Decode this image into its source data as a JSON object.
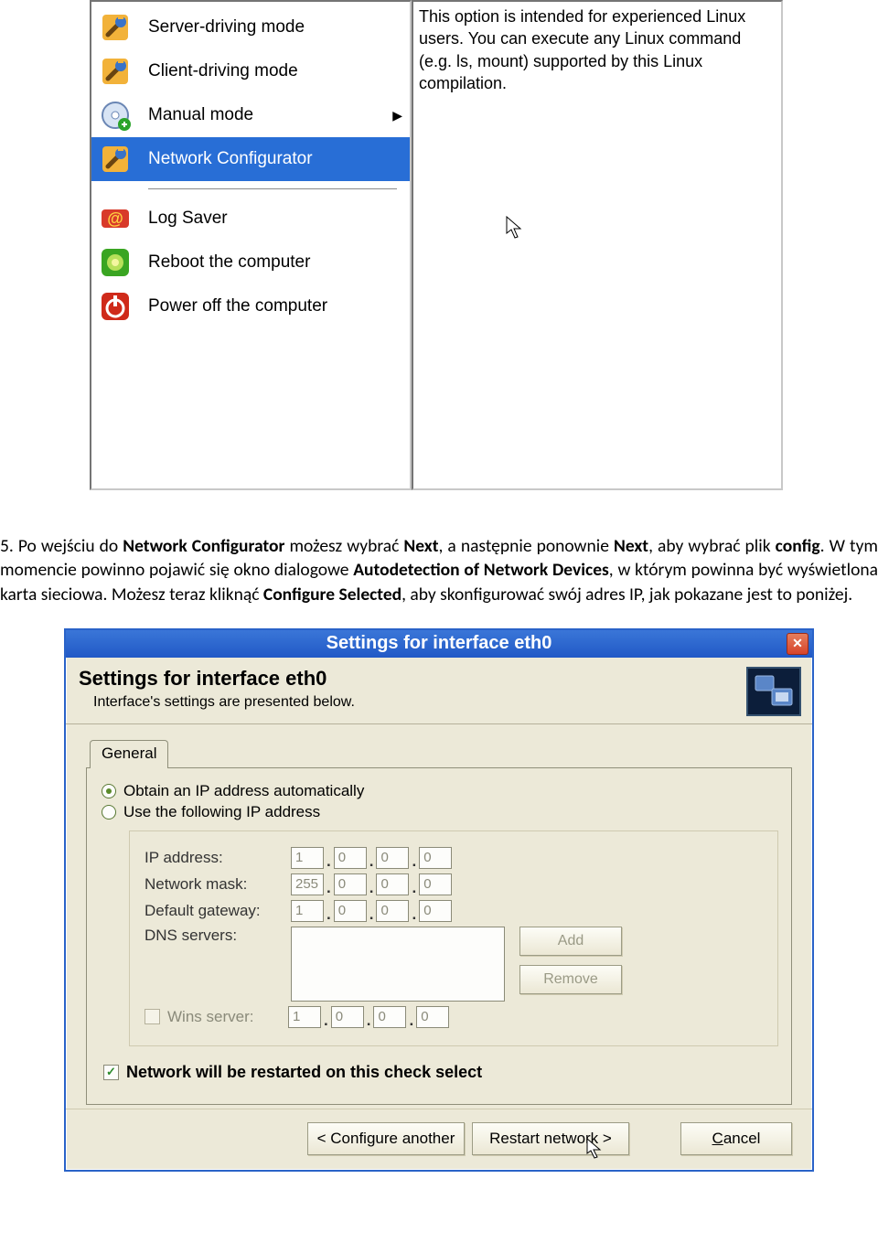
{
  "menu": {
    "items": [
      {
        "label": "Server-driving mode",
        "selected": false,
        "arrow": false,
        "icon": "wrench"
      },
      {
        "label": "Client-driving mode",
        "selected": false,
        "arrow": false,
        "icon": "wrench"
      },
      {
        "label": "Manual mode",
        "selected": false,
        "arrow": true,
        "icon": "cdwrench"
      },
      {
        "label": "Network Configurator",
        "selected": true,
        "arrow": false,
        "icon": "wrench"
      }
    ],
    "items2": [
      {
        "label": "Log Saver",
        "icon": "at"
      },
      {
        "label": "Reboot the computer",
        "icon": "reboot"
      },
      {
        "label": "Power off the computer",
        "icon": "power"
      }
    ],
    "info_text": "This option is intended for experienced Linux users. You can execute any Linux command (e.g. ls, mount) supported by this Linux compilation."
  },
  "paragraph": {
    "pre_bold1": "5. Po wejściu do ",
    "bold1": "Network Configurator",
    "mid1": " możesz wybrać ",
    "bold2": "Next",
    "mid2": ", a następnie ponownie ",
    "bold3": "Next",
    "mid3": ", aby wybrać plik ",
    "bold4": "config",
    "mid4": ". W tym momencie powinno pojawić się okno dialogowe ",
    "bold5": "Autodetection of Network Devices",
    "mid5": ", w którym powinna być wyświetlona karta sieciowa. Możesz teraz kliknąć ",
    "bold6": "Configure Selected",
    "tail": ", aby skonfigurować swój adres IP, jak pokazane jest to poniżej."
  },
  "dialog": {
    "title": "Settings for interface eth0",
    "header_title": "Settings for interface eth0",
    "header_sub": "Interface's settings are presented below.",
    "tab_label": "General",
    "radio_auto": "Obtain an IP address automatically",
    "radio_manual": "Use the following IP address",
    "labels": {
      "ip": "IP address:",
      "mask": "Network mask:",
      "gateway": "Default gateway:",
      "dns": "DNS servers:",
      "wins": "Wins server:"
    },
    "ip": [
      "1",
      "0",
      "0",
      "0"
    ],
    "mask": [
      "255",
      "0",
      "0",
      "0"
    ],
    "gateway": [
      "1",
      "0",
      "0",
      "0"
    ],
    "wins": [
      "1",
      "0",
      "0",
      "0"
    ],
    "btn_add": "Add",
    "btn_remove": "Remove",
    "checkbox": "Network will be restarted on this check select",
    "btn_prev": "< Configure another",
    "btn_next": "Restart network >",
    "btn_cancel": "Cancel"
  }
}
